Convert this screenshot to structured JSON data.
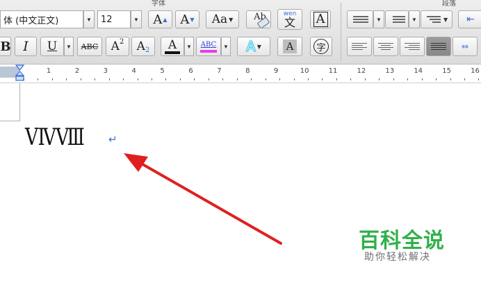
{
  "ribbon": {
    "font_group_title": "字体",
    "paragraph_group_title": "段落",
    "font_name": "体 (中文正文)",
    "font_size": "12",
    "grow_font_label": "A",
    "shrink_font_label": "A",
    "change_case_label": "Aa",
    "clear_format_label": "Ab",
    "phonetic_top": "wen",
    "phonetic_bottom": "文",
    "char_border_label": "A",
    "bold_label": "B",
    "italic_label": "I",
    "underline_label": "U",
    "strike_label": "ABC",
    "superscript_base": "A",
    "superscript_mark": "2",
    "subscript_base": "A",
    "subscript_mark": "2",
    "font_color_label": "A",
    "highlight_label": "ABC",
    "text_effect_label": "A",
    "char_shading_label": "A",
    "enclose_label": "字",
    "font_color_hex": "#111111",
    "highlight_color_hex": "#e040e8",
    "effect_color_hex": "#3cc8e8"
  },
  "ruler": {
    "numbers": [
      "1",
      "2",
      "3",
      "4",
      "5",
      "6",
      "7",
      "8",
      "9",
      "10",
      "11",
      "12",
      "13",
      "14",
      "15",
      "16"
    ]
  },
  "document": {
    "text": "ⅤⅣⅧ",
    "paragraph_mark": "↵",
    "arrow_color": "#e02020"
  },
  "watermark": {
    "title": "百科全说",
    "subtitle": "助你轻松解决",
    "title_color": "#2fb04a"
  }
}
